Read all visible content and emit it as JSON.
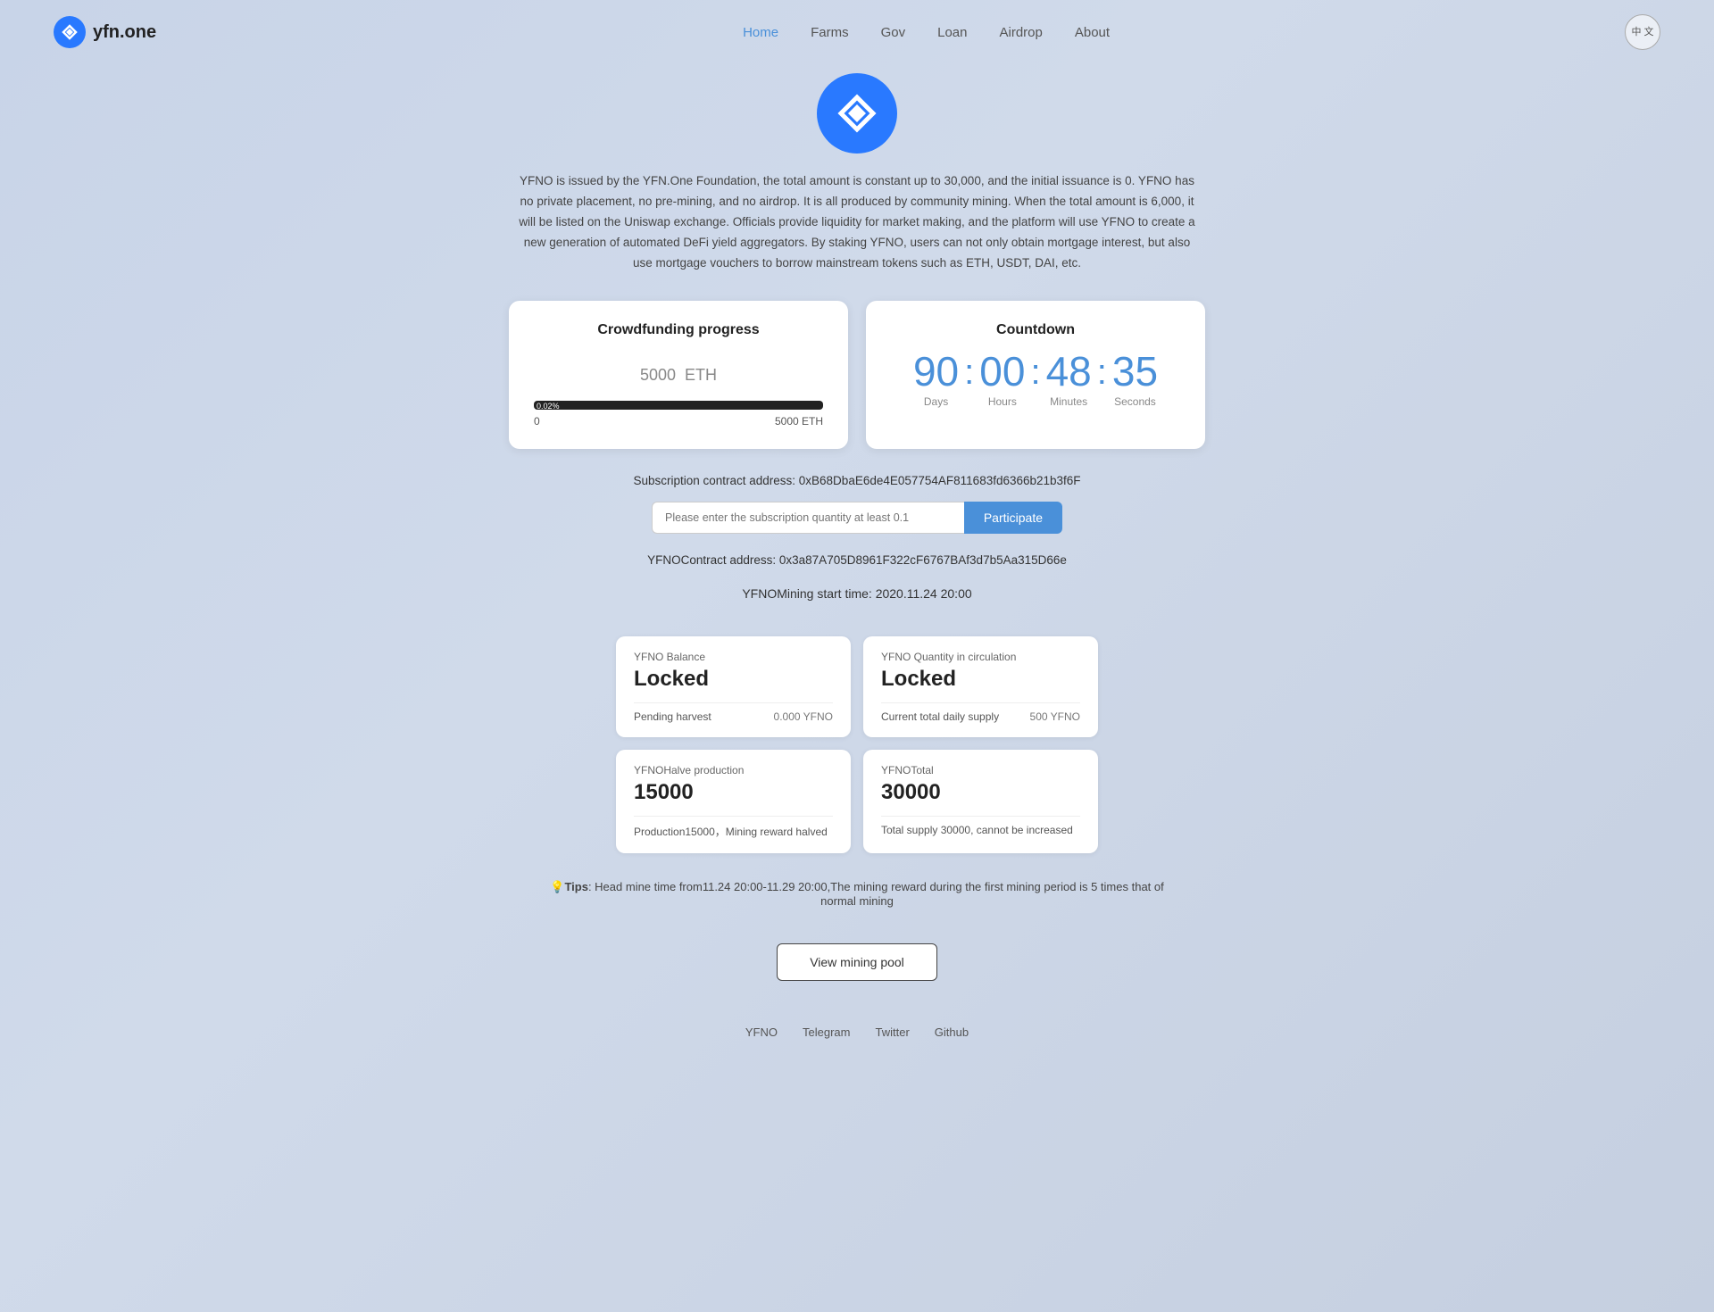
{
  "nav": {
    "logo_text": "yfn.one",
    "links": [
      {
        "label": "Home",
        "active": true
      },
      {
        "label": "Farms",
        "active": false
      },
      {
        "label": "Gov",
        "active": false
      },
      {
        "label": "Loan",
        "active": false
      },
      {
        "label": "Airdrop",
        "active": false
      },
      {
        "label": "About",
        "active": false
      }
    ],
    "lang_btn": "中\n文"
  },
  "hero": {
    "description": "YFNO is issued by the YFN.One Foundation, the total amount is constant up to 30,000, and the initial issuance is 0. YFNO has no private placement, no pre-mining, and no airdrop. It is all produced by community mining. When the total amount is 6,000, it will be listed on the Uniswap exchange. Officials provide liquidity for market making, and the platform will use YFNO to create a new generation of automated DeFi yield aggregators. By staking YFNO, users can not only obtain mortgage interest, but also use mortgage vouchers to borrow mainstream tokens such as ETH, USDT, DAI, etc."
  },
  "crowdfunding": {
    "title": "Crowdfunding progress",
    "amount": "5000",
    "unit": "ETH",
    "progress_percent": "0.02%",
    "range_min": "0",
    "range_max": "5000 ETH"
  },
  "countdown": {
    "title": "Countdown",
    "days": "90",
    "hours": "00",
    "minutes": "48",
    "seconds": "35",
    "label_days": "Days",
    "label_hours": "Hours",
    "label_minutes": "Minutes",
    "label_seconds": "Seconds"
  },
  "subscription": {
    "contract_label": "Subscription contract address: 0xB68DbaE6de4E057754AF811683fd6366b21b3f6F",
    "input_placeholder": "Please enter the subscription quantity at least 0.1",
    "participate_btn": "Participate"
  },
  "yfno": {
    "contract_label": "YFNOContract address: 0x3a87A705D8961F322cF6767BAf3d7b5Aa315D66e",
    "mining_start": "YFNOMining start time: 2020.11.24 20:00"
  },
  "info_cards": [
    {
      "subtitle": "YFNO Balance",
      "value": "Locked",
      "detail_label": "Pending harvest",
      "detail_amount": "0.000  YFNO"
    },
    {
      "subtitle": "YFNO Quantity in circulation",
      "value": "Locked",
      "detail_label": "Current total daily supply",
      "detail_amount": "500  YFNO"
    },
    {
      "subtitle": "YFNOHalve production",
      "value": "15000",
      "detail_label": "Production15000，Mining reward halved",
      "detail_amount": ""
    },
    {
      "subtitle": "YFNOTotal",
      "value": "30000",
      "detail_label": "Total supply 30000, cannot be increased",
      "detail_amount": ""
    }
  ],
  "tips": {
    "icon": "💡",
    "text": "Tips: Head mine time from11.24 20:00-11.29 20:00,The mining reward during the first mining period is 5 times that of normal mining"
  },
  "view_mining_btn": "View mining pool",
  "footer": {
    "links": [
      "YFNO",
      "Telegram",
      "Twitter",
      "Github"
    ]
  }
}
